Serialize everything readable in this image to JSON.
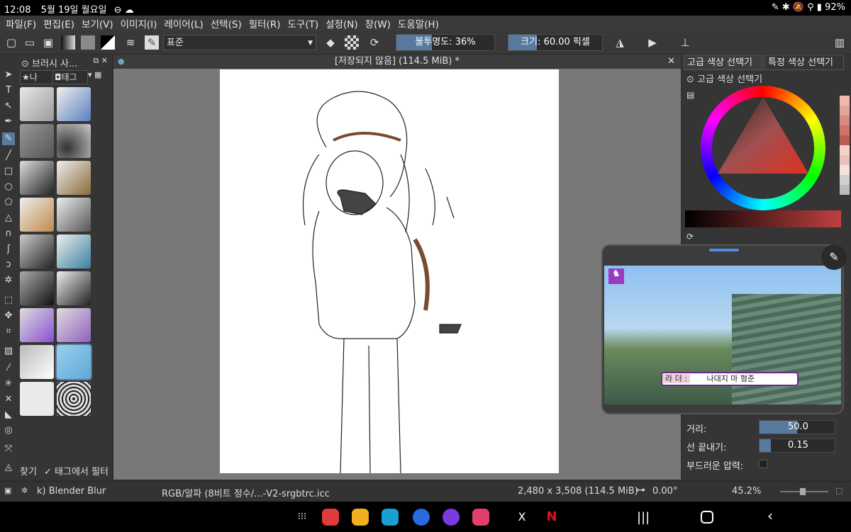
{
  "status": {
    "time": "12:08",
    "date": "5월 19일 월요일",
    "battery": "92%"
  },
  "menu": [
    "파일(F)",
    "편집(E)",
    "보기(V)",
    "이미지(I)",
    "레이어(L)",
    "선택(S)",
    "필터(R)",
    "도구(T)",
    "설정(N)",
    "창(W)",
    "도움말(H)"
  ],
  "toolbar": {
    "blend_mode": "표준",
    "opacity": "불투명도: 36%",
    "opacity_value": 0.36,
    "size": "크기: 60.00 픽셀",
    "size_value": 0.3
  },
  "brush_docker": {
    "title": "브러시 사...",
    "tab_favorites": "나",
    "tab_tags": "태그",
    "search_label": "찾기",
    "search_option": "태그에서 필터"
  },
  "document": {
    "title": "[저장되지 않음]  (114.5 MiB) *"
  },
  "right_panel": {
    "tab_advanced": "고급 색상 선택기",
    "tab_specific": "특정 색상 선택기",
    "color_selector_title": "고급 색상 선택기",
    "swatches": [
      "#f3b7ad",
      "#e6a59a",
      "#d98b80",
      "#cf7568",
      "#bf5d52",
      "#f6d1c8",
      "#e9c3bb",
      "#f8e1dc",
      "#d0d0d0",
      "#bbbbbb"
    ],
    "properties": [
      {
        "label": "거리:",
        "value": "50.0",
        "fraction": 0.5
      },
      {
        "label": "선 끝내기:",
        "value": "0.15",
        "fraction": 0.15
      },
      {
        "label": "부드러운 압력:",
        "value": ""
      }
    ]
  },
  "video": {
    "ladder_label": "라 더 :",
    "ladder_name": "나대지 마 형준"
  },
  "bottom": {
    "brush_name": "k) Blender Blur",
    "color_profile": "RGB/알파 (8비트 정수/...-V2-srgbtrc.icc",
    "dimensions": "2,480 x 3,508 (114.5 MiB)",
    "rotation": "0.00°",
    "zoom": "45.2%"
  },
  "navbar": {
    "x_label": "X",
    "netflix_label": "N"
  },
  "colors": {
    "accent": "#587a9e",
    "status_bg": "#000000"
  }
}
